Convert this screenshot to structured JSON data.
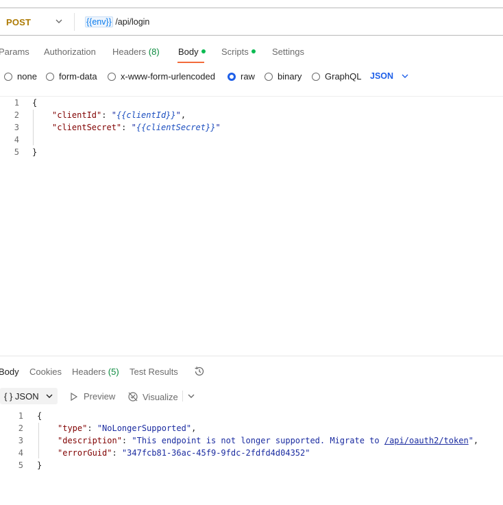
{
  "request": {
    "method": "POST",
    "url_var": "{{env}}",
    "url_path": " /api/login"
  },
  "request_tabs": [
    {
      "label": "Params"
    },
    {
      "label": "Authorization"
    },
    {
      "label": "Headers",
      "count": "(8)"
    },
    {
      "label": "Body"
    },
    {
      "label": "Scripts"
    },
    {
      "label": "Settings"
    }
  ],
  "body_types": [
    "none",
    "form-data",
    "x-www-form-urlencoded",
    "raw",
    "binary",
    "GraphQL"
  ],
  "body_selected": "raw",
  "body_language": "JSON",
  "request_body": {
    "line_numbers": [
      "1",
      "2",
      "3",
      "4",
      "5"
    ],
    "open": "{",
    "close": "}",
    "k1": "\"clientId\"",
    "q1a": "\"",
    "v1": "{{clientId}}",
    "q1b": "\"",
    "comma": ",",
    "k2": "\"clientSecret\"",
    "q2a": "\"",
    "v2": "{{clientSecret}}",
    "q2b": "\"",
    "colon": ": "
  },
  "response_tabs": [
    {
      "label": "Body"
    },
    {
      "label": "Cookies"
    },
    {
      "label": "Headers",
      "count": "(5)"
    },
    {
      "label": "Test Results"
    }
  ],
  "response_toolbar": {
    "format": "{ }  JSON",
    "preview": "Preview",
    "visualize": "Visualize"
  },
  "response_body": {
    "line_numbers": [
      "1",
      "2",
      "3",
      "4",
      "5"
    ],
    "open": "{",
    "close": "}",
    "k_type": "\"type\"",
    "v_type": "\"NoLongerSupported\"",
    "k_desc": "\"description\"",
    "v_desc_start": "\"This endpoint is not longer supported. Migrate to ",
    "v_desc_link": "/api/oauth2/token",
    "v_desc_end": "\"",
    "k_guid": "\"errorGuid\"",
    "v_guid": "\"347fcb81-36ac-45f9-9fdc-2fdfd4d04352\""
  },
  "colors": {
    "method": "#ad7a03",
    "accent": "#f26b3a",
    "selected_radio": "#1e5fe8",
    "status_dot": "#0cbb52",
    "json_key": "#800000",
    "json_string": "#1a2ba0"
  }
}
